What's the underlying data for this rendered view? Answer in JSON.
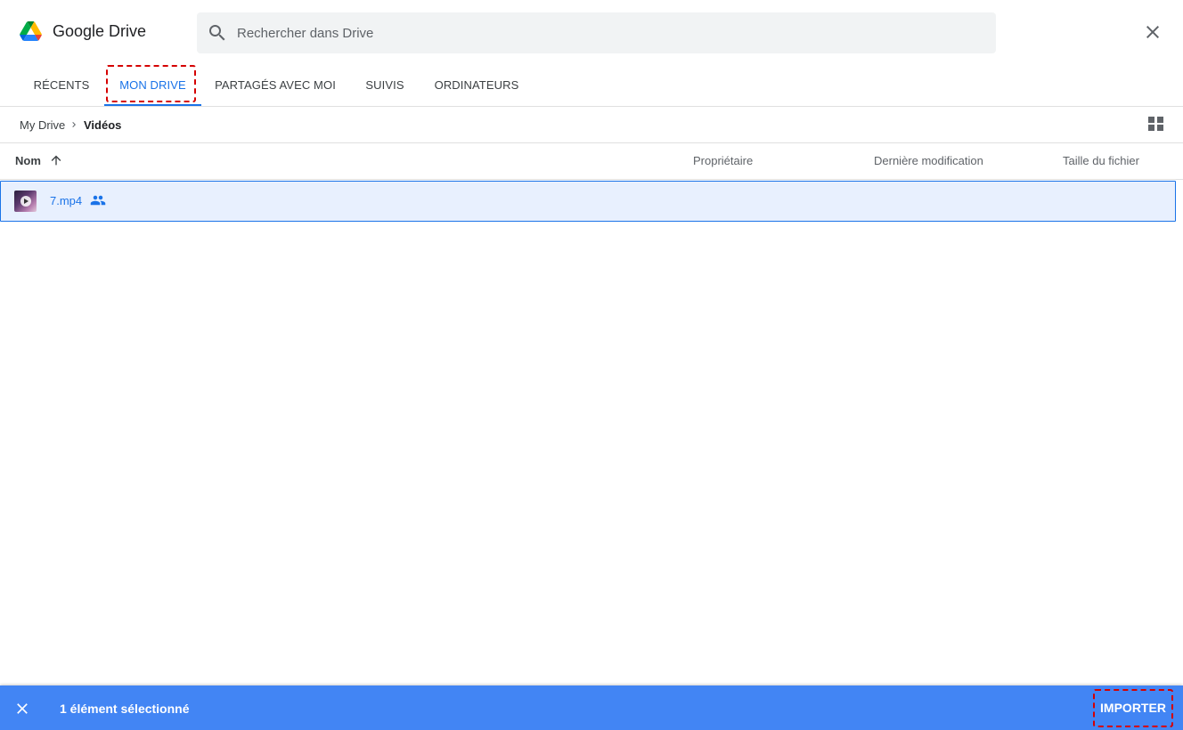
{
  "app": {
    "title": "Google Drive"
  },
  "search": {
    "placeholder": "Rechercher dans Drive",
    "value": ""
  },
  "tabs": [
    {
      "label": "RÉCENTS",
      "active": false
    },
    {
      "label": "MON DRIVE",
      "active": true
    },
    {
      "label": "PARTAGÉS AVEC MOI",
      "active": false
    },
    {
      "label": "SUIVIS",
      "active": false
    },
    {
      "label": "ORDINATEURS",
      "active": false
    }
  ],
  "breadcrumb": {
    "root": "My Drive",
    "current": "Vidéos"
  },
  "table": {
    "columns": {
      "name": "Nom",
      "owner": "Propriétaire",
      "modified": "Dernière modification",
      "size": "Taille du fichier"
    },
    "rows": [
      {
        "name": "7.mp4",
        "shared": true,
        "selected": true,
        "owner": "",
        "modified": "",
        "size": ""
      }
    ]
  },
  "bottom_bar": {
    "selection_text": "1 élément sélectionné",
    "import_label": "IMPORTER"
  },
  "icons": {
    "logo": "google-drive-logo",
    "search": "search-icon",
    "close": "close-icon",
    "breadcrumb_separator": "chevron-right-icon",
    "view_toggle": "grid-view-icon",
    "sort": "arrow-up-icon",
    "shared": "people-icon"
  },
  "colors": {
    "accent": "#1a73e8",
    "bottom_bar": "#4285f4",
    "selected_row": "#e8f0fe",
    "highlight_annotation": "#d50000"
  }
}
